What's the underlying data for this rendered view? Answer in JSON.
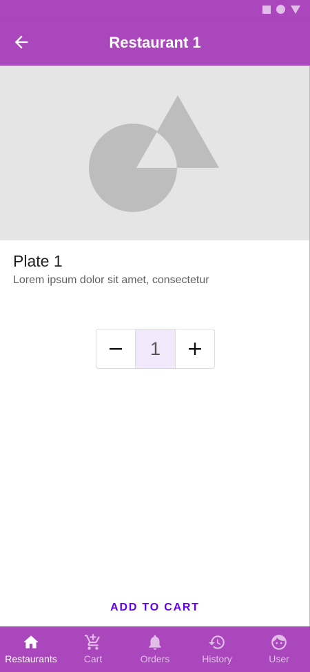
{
  "colors": {
    "primary": "#ab47bc",
    "accent": "#6200ee",
    "inactive_nav": "#e1bee7"
  },
  "status_bar": {
    "icons": [
      "square-icon",
      "circle-icon",
      "triangle-icon"
    ]
  },
  "app_bar": {
    "title": "Restaurant 1",
    "back_icon": "arrow-back-icon"
  },
  "plate": {
    "name": "Plate 1",
    "description": "Lorem ipsum dolor sit amet, consectetur"
  },
  "stepper": {
    "decrement_label": "−",
    "quantity": "1",
    "increment_label": "+"
  },
  "add_to_cart_label": "ADD TO CART",
  "bottom_nav": {
    "active": "Restaurants",
    "items": [
      {
        "label": "Restaurants",
        "icon": "home-icon"
      },
      {
        "label": "Cart",
        "icon": "cart-add-icon"
      },
      {
        "label": "Orders",
        "icon": "bell-icon"
      },
      {
        "label": "History",
        "icon": "history-icon"
      },
      {
        "label": "User",
        "icon": "face-icon"
      }
    ]
  }
}
